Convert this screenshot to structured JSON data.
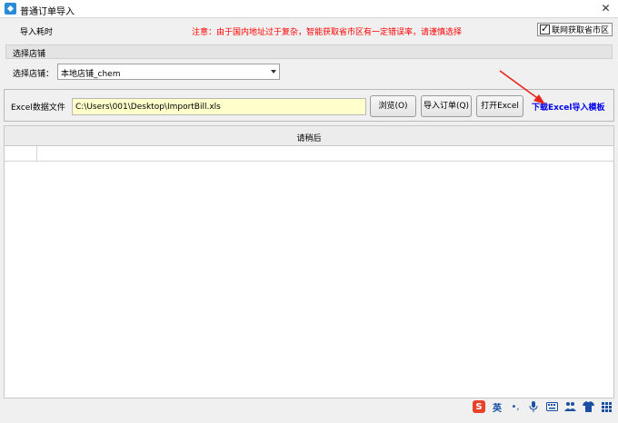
{
  "window": {
    "title": "普通订单导入",
    "close_symbol": "✕"
  },
  "topbar": {
    "import_time_label": "导入耗时",
    "notice": "注意：由于国内地址过于复杂，智能获取省市区有一定错误率，请谨慎选择",
    "network_checkbox": {
      "label": "联网获取省市区",
      "checked": true
    }
  },
  "store_section": {
    "header": "选择店铺",
    "label": "选择店铺：",
    "selected": "本地店铺_chem"
  },
  "excel_section": {
    "label": "Excel数据文件",
    "path": "C:\\Users\\001\\Desktop\\ImportBill.xls",
    "browse_button": "浏览(O)",
    "import_button": "导入订单(Q)",
    "open_excel_button": "打开Excel",
    "download_link": "下载Excel导入模板"
  },
  "status": {
    "text": "请稍后"
  },
  "annotation": {
    "arrow_color": "#e8251b"
  },
  "tray": {
    "ime_logo": "S",
    "ime_lang": "英",
    "icons": [
      "punctuation-icon",
      "microphone-icon",
      "keyboard-icon",
      "people-icon",
      "shirt-icon",
      "grid-icon"
    ]
  }
}
